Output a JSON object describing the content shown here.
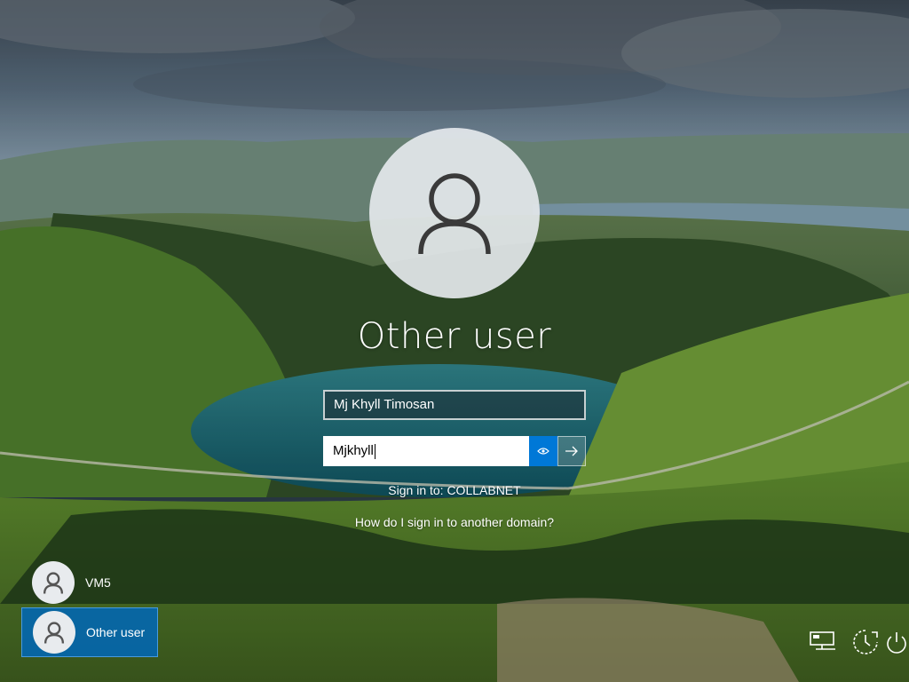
{
  "login": {
    "display_name": "Other user",
    "username_value": "Mj Khyll Timosan",
    "password_value": "Mjkhyll",
    "signin_to": "Sign in to: COLLABNET",
    "other_domain_link": "How do I sign in to another domain?"
  },
  "user_list": [
    {
      "name": "VM5",
      "selected": false
    },
    {
      "name": "Other user",
      "selected": true
    }
  ],
  "system_icons": [
    {
      "icon": "network-icon"
    },
    {
      "icon": "ease-of-access-icon"
    },
    {
      "icon": "power-icon"
    }
  ],
  "colors": {
    "accent": "#0078d7",
    "selected_tile": "#0067b8"
  }
}
